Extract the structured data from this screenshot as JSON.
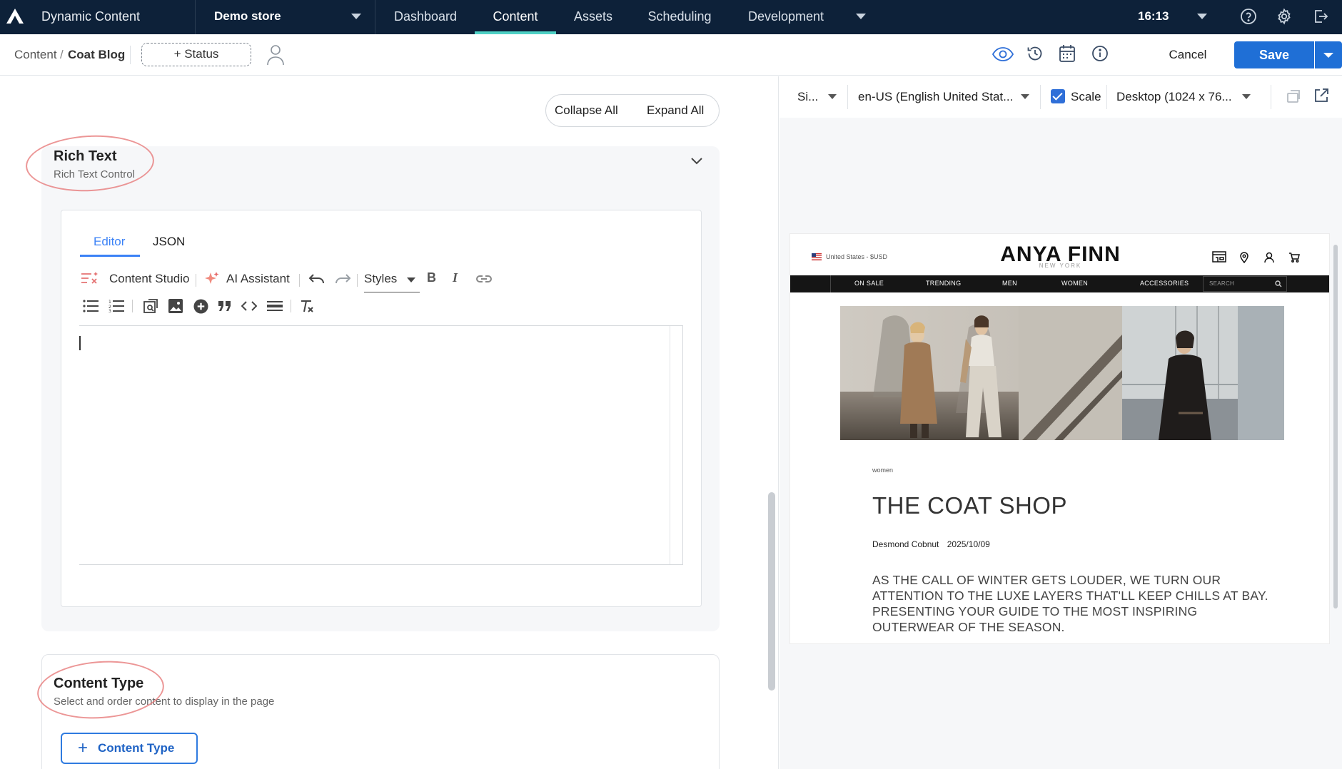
{
  "topnav": {
    "app_name": "Dynamic Content",
    "store": "Demo store",
    "nav": [
      "Dashboard",
      "Content",
      "Assets",
      "Scheduling",
      "Development"
    ],
    "active_nav": "Content",
    "clock": "16:13",
    "icons": [
      "help-icon",
      "gear-icon",
      "logout-icon"
    ]
  },
  "subbar": {
    "breadcrumb_root": "Content",
    "breadcrumb_sep": "/",
    "breadcrumb_current": "Coat Blog",
    "status_button": "+ Status",
    "cancel": "Cancel",
    "save": "Save",
    "icons": [
      "eye-icon",
      "history-icon",
      "calendar-icon",
      "info-icon"
    ]
  },
  "left": {
    "collapse_all": "Collapse All",
    "expand_all": "Expand All",
    "rich_text": {
      "title": "Rich Text",
      "subtitle": "Rich Text Control",
      "tabs": [
        "Editor",
        "JSON"
      ],
      "active_tab": "Editor",
      "toolbar": {
        "content_studio": "Content Studio",
        "ai_assistant": "AI Assistant",
        "styles": "Styles",
        "bold": "B",
        "italic": "I"
      },
      "content": ""
    },
    "content_type": {
      "title": "Content Type",
      "subtitle": "Select and order content to display in the page",
      "button": "Content Type",
      "plus": "+"
    }
  },
  "preview": {
    "toolbar": {
      "site": "Si...",
      "locale": "en-US (English United Stat...",
      "scale_label": "Scale",
      "scale_checked": true,
      "device": "Desktop (1024 x 76..."
    },
    "site": {
      "locale": "United States - $USD",
      "brand": "ANYA FINN",
      "brand_sub": "NEW YORK",
      "nav": [
        "ON SALE",
        "TRENDING",
        "MEN",
        "WOMEN",
        "ACCESSORIES"
      ],
      "search_placeholder": "SEARCH",
      "category": "women",
      "title": "THE COAT SHOP",
      "author": "Desmond Cobnut",
      "date": "2025/10/09",
      "body": "AS THE CALL OF WINTER GETS LOUDER, WE TURN OUR ATTENTION TO THE LUXE LAYERS THAT'LL KEEP CHILLS AT BAY. PRESENTING YOUR GUIDE TO THE MOST INSPIRING OUTERWEAR OF THE SEASON."
    }
  },
  "colors": {
    "nav_bg": "#0d2139",
    "accent": "#4fd1c5",
    "primary": "#1f6fd6",
    "annotation": "#e57373"
  }
}
